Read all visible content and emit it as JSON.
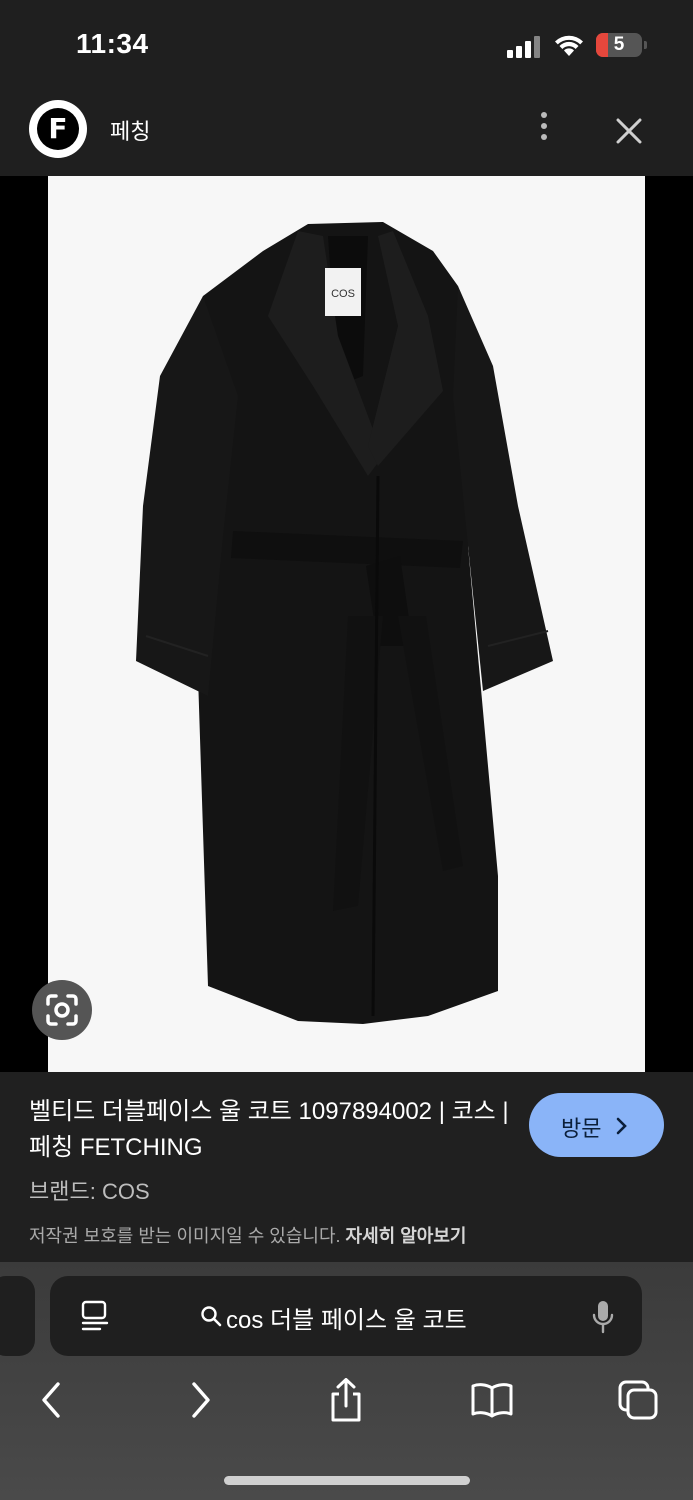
{
  "status_bar": {
    "time": "11:34",
    "battery": "5"
  },
  "header": {
    "logo_letter": "F",
    "site_name": "페칭"
  },
  "product_image": {
    "label_text": "COS"
  },
  "info": {
    "title": "벨티드 더블페이스 울 코트 1097894002 | 코스 | 페칭 FETCHING",
    "visit_label": "방문",
    "visit_chevron": "›",
    "brand": "브랜드: COS",
    "copyright": "저작권 보호를 받는 이미지일 수 있습니다.",
    "learn_more": "자세히 알아보기"
  },
  "search": {
    "query": "cos 더블 페이스 울 코트"
  },
  "colors": {
    "accent": "#8ab4f8",
    "background": "#1f1f1f"
  }
}
